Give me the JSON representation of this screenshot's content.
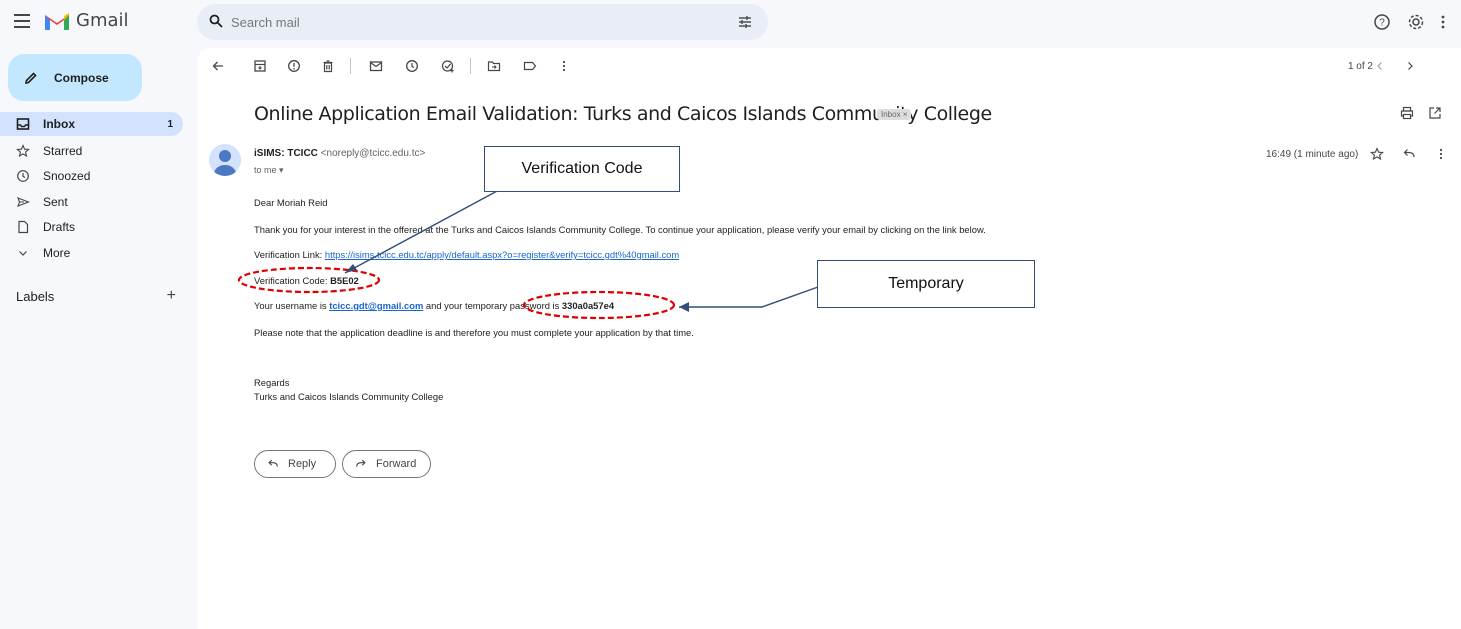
{
  "app": {
    "name": "Gmail"
  },
  "search": {
    "placeholder": "Search mail"
  },
  "sidebar": {
    "compose_label": "Compose",
    "items": [
      {
        "label": "Inbox",
        "count": "1",
        "icon": "inbox-icon"
      },
      {
        "label": "Starred",
        "icon": "star-icon"
      },
      {
        "label": "Snoozed",
        "icon": "clock-icon"
      },
      {
        "label": "Sent",
        "icon": "send-icon"
      },
      {
        "label": "Drafts",
        "icon": "draft-icon"
      },
      {
        "label": "More",
        "icon": "chevron-down-icon"
      }
    ],
    "labels_title": "Labels",
    "labels_add": "+"
  },
  "toolbar": {
    "pager": "1 of 2"
  },
  "email": {
    "subject": "Online Application Email Validation: Turks and Caicos Islands Community College",
    "inbox_chip": "Inbox ×",
    "sender_name": "iSIMS: TCICC",
    "sender_email": "<noreply@tcicc.edu.tc>",
    "to": "to me ▾",
    "time": "16:49 (1 minute ago)",
    "greeting": "Dear Moriah Reid",
    "intro": "Thank you for your interest in the offered at the Turks and Caicos Islands Community College. To continue your application, please verify your email by clicking on the link below.",
    "verification_link_label": "Verification Link: ",
    "verification_link": "https://isims.tcicc.edu.tc/apply/default.aspx?o=register&verify=tcicc.gdt%40gmail.com",
    "verification_code_label": "Verification Code: ",
    "verification_code": "B5E02",
    "username_prefix": "Your username is ",
    "username": "tcicc.gdt@gmail.com",
    "username_mid": " and your temporary password is ",
    "password": "330a0a57e4",
    "deadline_note": "Please note that the application deadline is and therefore you must complete your application by that time.",
    "regards": "Regards",
    "signature": "Turks and Caicos Islands Community College"
  },
  "actions": {
    "reply": "Reply",
    "forward": "Forward"
  },
  "annotations": {
    "verification_callout": "Verification Code",
    "temporary_callout": "Temporary",
    "color": "#2f4f78",
    "circle_color": "#e00000"
  }
}
